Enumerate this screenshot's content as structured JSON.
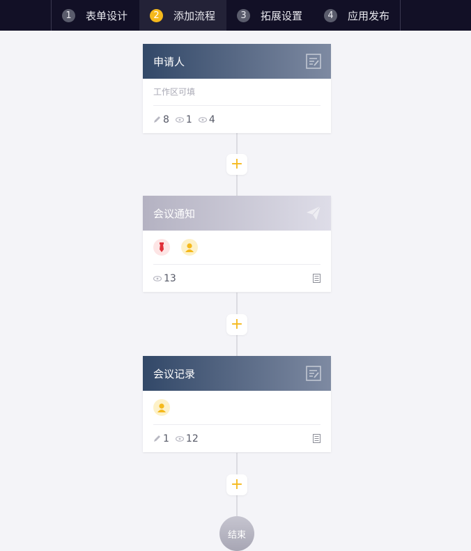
{
  "steps": [
    {
      "num": "1",
      "label": "表单设计"
    },
    {
      "num": "2",
      "label": "添加流程"
    },
    {
      "num": "3",
      "label": "拓展设置"
    },
    {
      "num": "4",
      "label": "应用发布"
    }
  ],
  "nodes": [
    {
      "title": "申请人",
      "subtitle": "工作区可填",
      "edit": "8",
      "view": "1",
      "read": "4",
      "icon": "form-edit-icon"
    },
    {
      "title": "会议通知",
      "view": "13",
      "icon": "paper-plane-icon"
    },
    {
      "title": "会议记录",
      "edit": "1",
      "view": "12",
      "icon": "form-edit-icon"
    }
  ],
  "end_label": "结束",
  "colors": {
    "accent": "#f5b91c",
    "topbar": "#121026"
  }
}
